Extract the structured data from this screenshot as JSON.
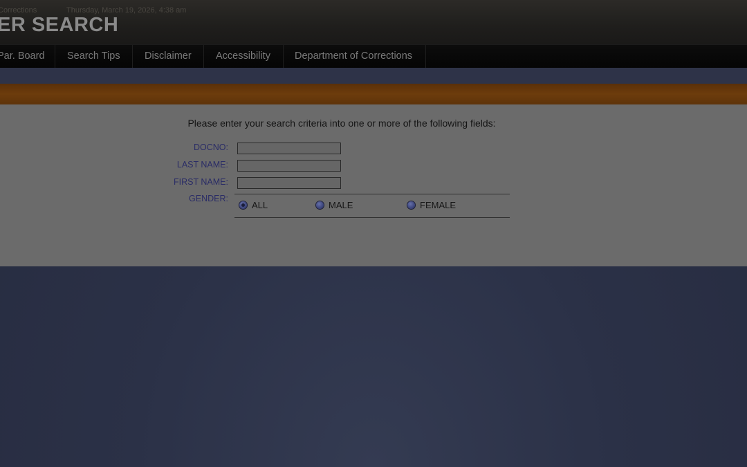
{
  "header": {
    "agency": "Corrections",
    "datetime": "Thursday, March 19, 2026, 4:38 am",
    "title": "ER SEARCH"
  },
  "nav": {
    "items": [
      {
        "label": "Par. Board"
      },
      {
        "label": "Search Tips"
      },
      {
        "label": "Disclaimer"
      },
      {
        "label": "Accessibility"
      },
      {
        "label": "Department of Corrections"
      }
    ]
  },
  "form": {
    "instructions": "Please enter your search criteria into one or more of the following fields:",
    "docno": {
      "label": "DOCNO:",
      "value": ""
    },
    "last_name": {
      "label": "LAST NAME:",
      "value": ""
    },
    "first_name": {
      "label": "FIRST NAME:",
      "value": ""
    },
    "gender": {
      "label": "GENDER:",
      "selected": "ALL",
      "options": [
        {
          "label": "ALL"
        },
        {
          "label": "MALE"
        },
        {
          "label": "FEMALE"
        }
      ]
    }
  }
}
